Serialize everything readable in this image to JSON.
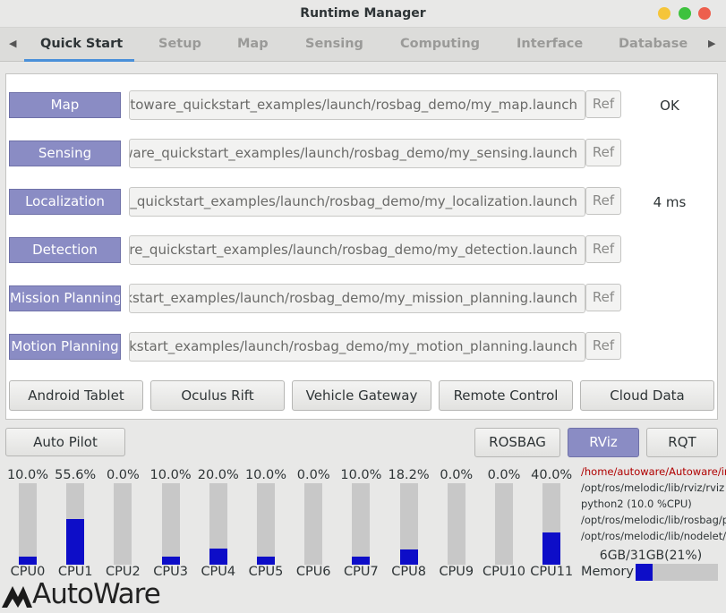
{
  "window": {
    "title": "Runtime Manager"
  },
  "tabs": [
    {
      "label": "Quick Start"
    },
    {
      "label": "Setup"
    },
    {
      "label": "Map"
    },
    {
      "label": "Sensing"
    },
    {
      "label": "Computing"
    },
    {
      "label": "Interface"
    },
    {
      "label": "Database"
    }
  ],
  "quickstart": {
    "rows": [
      {
        "label": "Map",
        "path": "utoware_quickstart_examples/launch/rosbag_demo/my_map.launch",
        "ref": "Ref",
        "status": "OK"
      },
      {
        "label": "Sensing",
        "path": "ware_quickstart_examples/launch/rosbag_demo/my_sensing.launch",
        "ref": "Ref",
        "status": ""
      },
      {
        "label": "Localization",
        "path": "e_quickstart_examples/launch/rosbag_demo/my_localization.launch",
        "ref": "Ref",
        "status": "4 ms"
      },
      {
        "label": "Detection",
        "path": "are_quickstart_examples/launch/rosbag_demo/my_detection.launch",
        "ref": "Ref",
        "status": ""
      },
      {
        "label": "Mission Planning",
        "path": "kstart_examples/launch/rosbag_demo/my_mission_planning.launch",
        "ref": "Ref",
        "status": ""
      },
      {
        "label": "Motion Planning",
        "path": "ckstart_examples/launch/rosbag_demo/my_motion_planning.launch",
        "ref": "Ref",
        "status": ""
      }
    ],
    "bottom_buttons": [
      "Android Tablet",
      "Oculus Rift",
      "Vehicle Gateway",
      "Remote Control",
      "Cloud Data"
    ]
  },
  "footer_buttons": {
    "auto_pilot": "Auto Pilot",
    "rosbag": "ROSBAG",
    "rviz": "RViz",
    "rqt": "RQT"
  },
  "cpus": [
    {
      "name": "CPU0",
      "pct": "10.0%",
      "value": 10.0
    },
    {
      "name": "CPU1",
      "pct": "55.6%",
      "value": 55.6
    },
    {
      "name": "CPU2",
      "pct": "0.0%",
      "value": 0.0
    },
    {
      "name": "CPU3",
      "pct": "10.0%",
      "value": 10.0
    },
    {
      "name": "CPU4",
      "pct": "20.0%",
      "value": 20.0
    },
    {
      "name": "CPU5",
      "pct": "10.0%",
      "value": 10.0
    },
    {
      "name": "CPU6",
      "pct": "0.0%",
      "value": 0.0
    },
    {
      "name": "CPU7",
      "pct": "10.0%",
      "value": 10.0
    },
    {
      "name": "CPU8",
      "pct": "18.2%",
      "value": 18.2
    },
    {
      "name": "CPU9",
      "pct": "0.0%",
      "value": 0.0
    },
    {
      "name": "CPU10",
      "pct": "0.0%",
      "value": 0.0
    },
    {
      "name": "CPU11",
      "pct": "40.0%",
      "value": 40.0
    }
  ],
  "processes": [
    "/home/autoware/Autoware/ir",
    "/opt/ros/melodic/lib/rviz/rviz (",
    "python2 (10.0 %CPU)",
    "/opt/ros/melodic/lib/rosbag/p",
    "/opt/ros/melodic/lib/nodelet/"
  ],
  "memory": {
    "text": "6GB/31GB(21%)",
    "label": "Memory",
    "fraction": 0.21
  },
  "logo": {
    "text": "AutoWare"
  },
  "colors": {
    "accent": "#4a90d9",
    "button_purple": "#8a8cc4",
    "cpu_fill": "#0d0dc8",
    "close": "#ed5f4d",
    "minimize": "#f5c53a",
    "maximize": "#3ec23e"
  }
}
